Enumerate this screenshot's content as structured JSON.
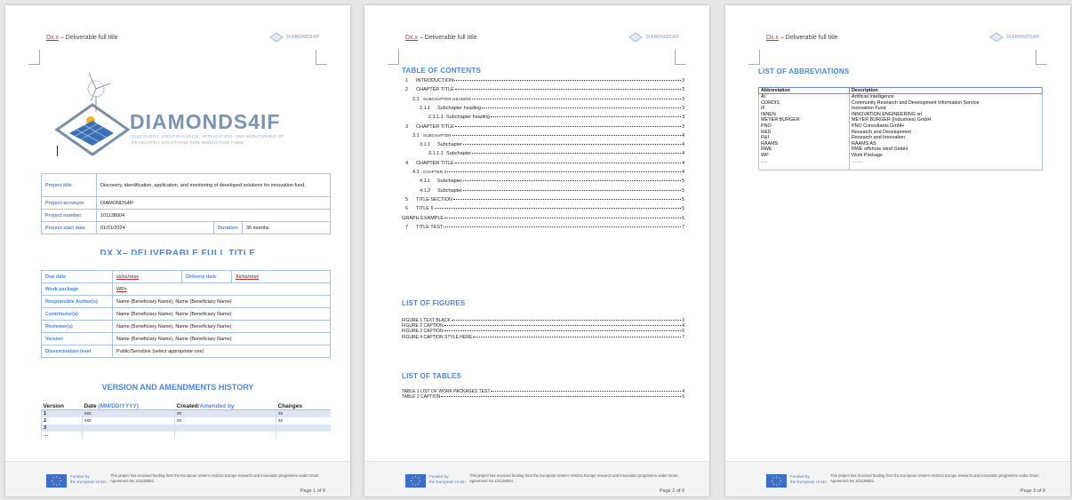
{
  "header": {
    "code": "Dx.x",
    "title_rest": " – Deliverable full title",
    "logo_text": "DIAMONDS4IF"
  },
  "footer": {
    "funded_line1": "Funded by",
    "funded_line2": "the European Union",
    "funding_text": "This project has received funding from the European Union's Horizon Europe research and innovation programme under Grant Agreement No 101138004.",
    "page_labels": [
      "Page 1 of 9",
      "Page 2 of 9",
      "Page 3 of 9"
    ]
  },
  "cover": {
    "brand": "DIAMONDS4IF",
    "brand_sub_line1": "DISCOVERY, IDENTIFICATION, APPLICATION, AND MONITORING OF",
    "brand_sub_line2": "DEVELOPED SOLUTIONS FOR INNOVATION FUND",
    "project": {
      "title_label": "Project title",
      "title_value": "Discovery, identification, application, and monitoring of developed solutions for innovation fund.",
      "acronym_label": "Project acronym",
      "acronym_value": "DIAMONDS4IF",
      "number_label": "Project number",
      "number_value": "101138004",
      "start_label": "Project start date",
      "start_value": "01/01/2024",
      "duration_label": "Duration",
      "duration_value": "36 months"
    },
    "deliverable_title": "DX.X– DELIVERABLE FULL TITLE",
    "deliverable": {
      "due_label": "Due date",
      "due_value": "xx/xx/xxxx",
      "delivery_label": "Delivery date",
      "delivery_value": "Xx/xx/xxxx",
      "wp_label": "Work package",
      "wp_value": "WPx",
      "rows": [
        {
          "label": "Responsible Author(s)",
          "value": "Name (Beneficiary Name), Name (Beneficiary Name)"
        },
        {
          "label": "Contributor(s)",
          "value": "Name (Beneficiary Name), Name (Beneficiary Name)"
        },
        {
          "label": "Reviewer(s)",
          "value": "Name (Beneficiary Name), Name (Beneficiary Name)"
        },
        {
          "label": "Version",
          "value": "Name (Beneficiary Name), Name (Beneficiary Name)"
        },
        {
          "label": "Dissemination level",
          "value": "Public/Sensitive (select appropriate one)"
        }
      ]
    },
    "version_history_title": "VERSION AND AMENDMENTS HISTORY",
    "version_headers": {
      "version": "Version",
      "date_a": "Date ",
      "date_b": "(MM/DD/YYYY)",
      "created_a": "Created",
      "created_b": "/Amended by",
      "changes": "Changes"
    },
    "version_rows": [
      {
        "version": "1",
        "date": "xxx",
        "by": "xx",
        "changes": "xx"
      },
      {
        "version": "2",
        "date": "xxx",
        "by": "xx",
        "changes": "xx"
      },
      {
        "version": "3",
        "date": "",
        "by": "",
        "changes": ""
      },
      {
        "version": "…",
        "date": "",
        "by": "",
        "changes": ""
      }
    ]
  },
  "toc": {
    "heading": "TABLE OF CONTENTS",
    "entries": [
      {
        "num": "1",
        "text": "INTRODUCTION",
        "page": "3",
        "small": false
      },
      {
        "num": "2",
        "text": "CHAPTER TITLE",
        "page": "3",
        "small": false
      },
      {
        "num": "2.1",
        "text": "SUBCHAPTER HEADING",
        "page": "3",
        "small": true
      },
      {
        "num": "2.1.1",
        "text": "Subchapter heading",
        "page": "3",
        "small": false
      },
      {
        "num": "2.1.1.1",
        "text": "Subchapter heading",
        "page": "3",
        "small": false
      },
      {
        "num": "3",
        "text": "CHAPTER TITLE",
        "page": "3",
        "small": false
      },
      {
        "num": "3.1",
        "text": "SUBCHAPTER",
        "page": "4",
        "small": true
      },
      {
        "num": "3.1.1",
        "text": "Subchapter",
        "page": "4",
        "small": false
      },
      {
        "num": "3.1.1.1",
        "text": "Subchapter",
        "page": "4",
        "small": false
      },
      {
        "num": "4",
        "text": "CHAPTER TITLE",
        "page": "4",
        "small": false
      },
      {
        "num": "4.1",
        "text": "CHAPTER 3",
        "page": "4",
        "small": true
      },
      {
        "num": "4.1.1",
        "text": "Subchapter",
        "page": "5",
        "small": false
      },
      {
        "num": "4.1.2",
        "text": "Subchapter",
        "page": "5",
        "small": false
      },
      {
        "num": "5",
        "text": "TITLE SECTION",
        "page": "5",
        "small": false
      },
      {
        "num": "6",
        "text": "TITLE 6",
        "page": "5",
        "small": false
      },
      {
        "num": "",
        "text": "GRAPH EXAMPLE",
        "page": "6",
        "small": false
      },
      {
        "num": "7",
        "text": "TITLE TEST",
        "page": "7",
        "small": false
      }
    ]
  },
  "figures": {
    "heading": "LIST OF FIGURES",
    "entries": [
      {
        "text": "FIGURE 1 TEXT BLACK",
        "page": "3"
      },
      {
        "text": "FIGURE 2 CAPTION",
        "page": "4"
      },
      {
        "text": "FIGURE 3 CAPTION",
        "page": "6"
      },
      {
        "text": "FIGURE 4 CAPTION STYLE HERE",
        "page": "7"
      }
    ]
  },
  "tables": {
    "heading": "LIST OF TABLES",
    "entries": [
      {
        "text": "TABLE 1 LIST OF WORK PACKAGES TEST",
        "page": "4"
      },
      {
        "text": "TABLE 2 CAPTION",
        "page": "6"
      }
    ]
  },
  "abbreviations": {
    "heading": "LIST OF ABBREVIATIONS",
    "col_abbr": "Abbreviation",
    "col_desc": "Description",
    "rows": [
      {
        "abbr": "AI",
        "desc": "Artificial Intelligence"
      },
      {
        "abbr": "CORDIS",
        "desc": "Community Research and Development Information Service"
      },
      {
        "abbr": "IF",
        "desc": "Innovation Fund"
      },
      {
        "abbr": "INNEN",
        "desc": "INNOVATION ENGINEERING srl"
      },
      {
        "abbr": "MEYER BURGER",
        "desc": "MEYER BURGER (Industries) GmbH"
      },
      {
        "abbr": "PNO",
        "desc": "PNO Consultants GmbH"
      },
      {
        "abbr": "R&D",
        "desc": "Research and Development"
      },
      {
        "abbr": "R&I",
        "desc": "Research and Innovation"
      },
      {
        "abbr": "RAAMS",
        "desc": "RAAMS AS"
      },
      {
        "abbr": "RWE",
        "desc": "RWE offshore wind GmbH"
      },
      {
        "abbr": "WP",
        "desc": "Work Package"
      },
      {
        "abbr": "….",
        "desc": "……."
      },
      {
        "abbr": "",
        "desc": ""
      }
    ]
  },
  "colors": {
    "accent": "#4a86e8",
    "table_border": "#a7c1e8",
    "brand": "#7b93b5"
  }
}
